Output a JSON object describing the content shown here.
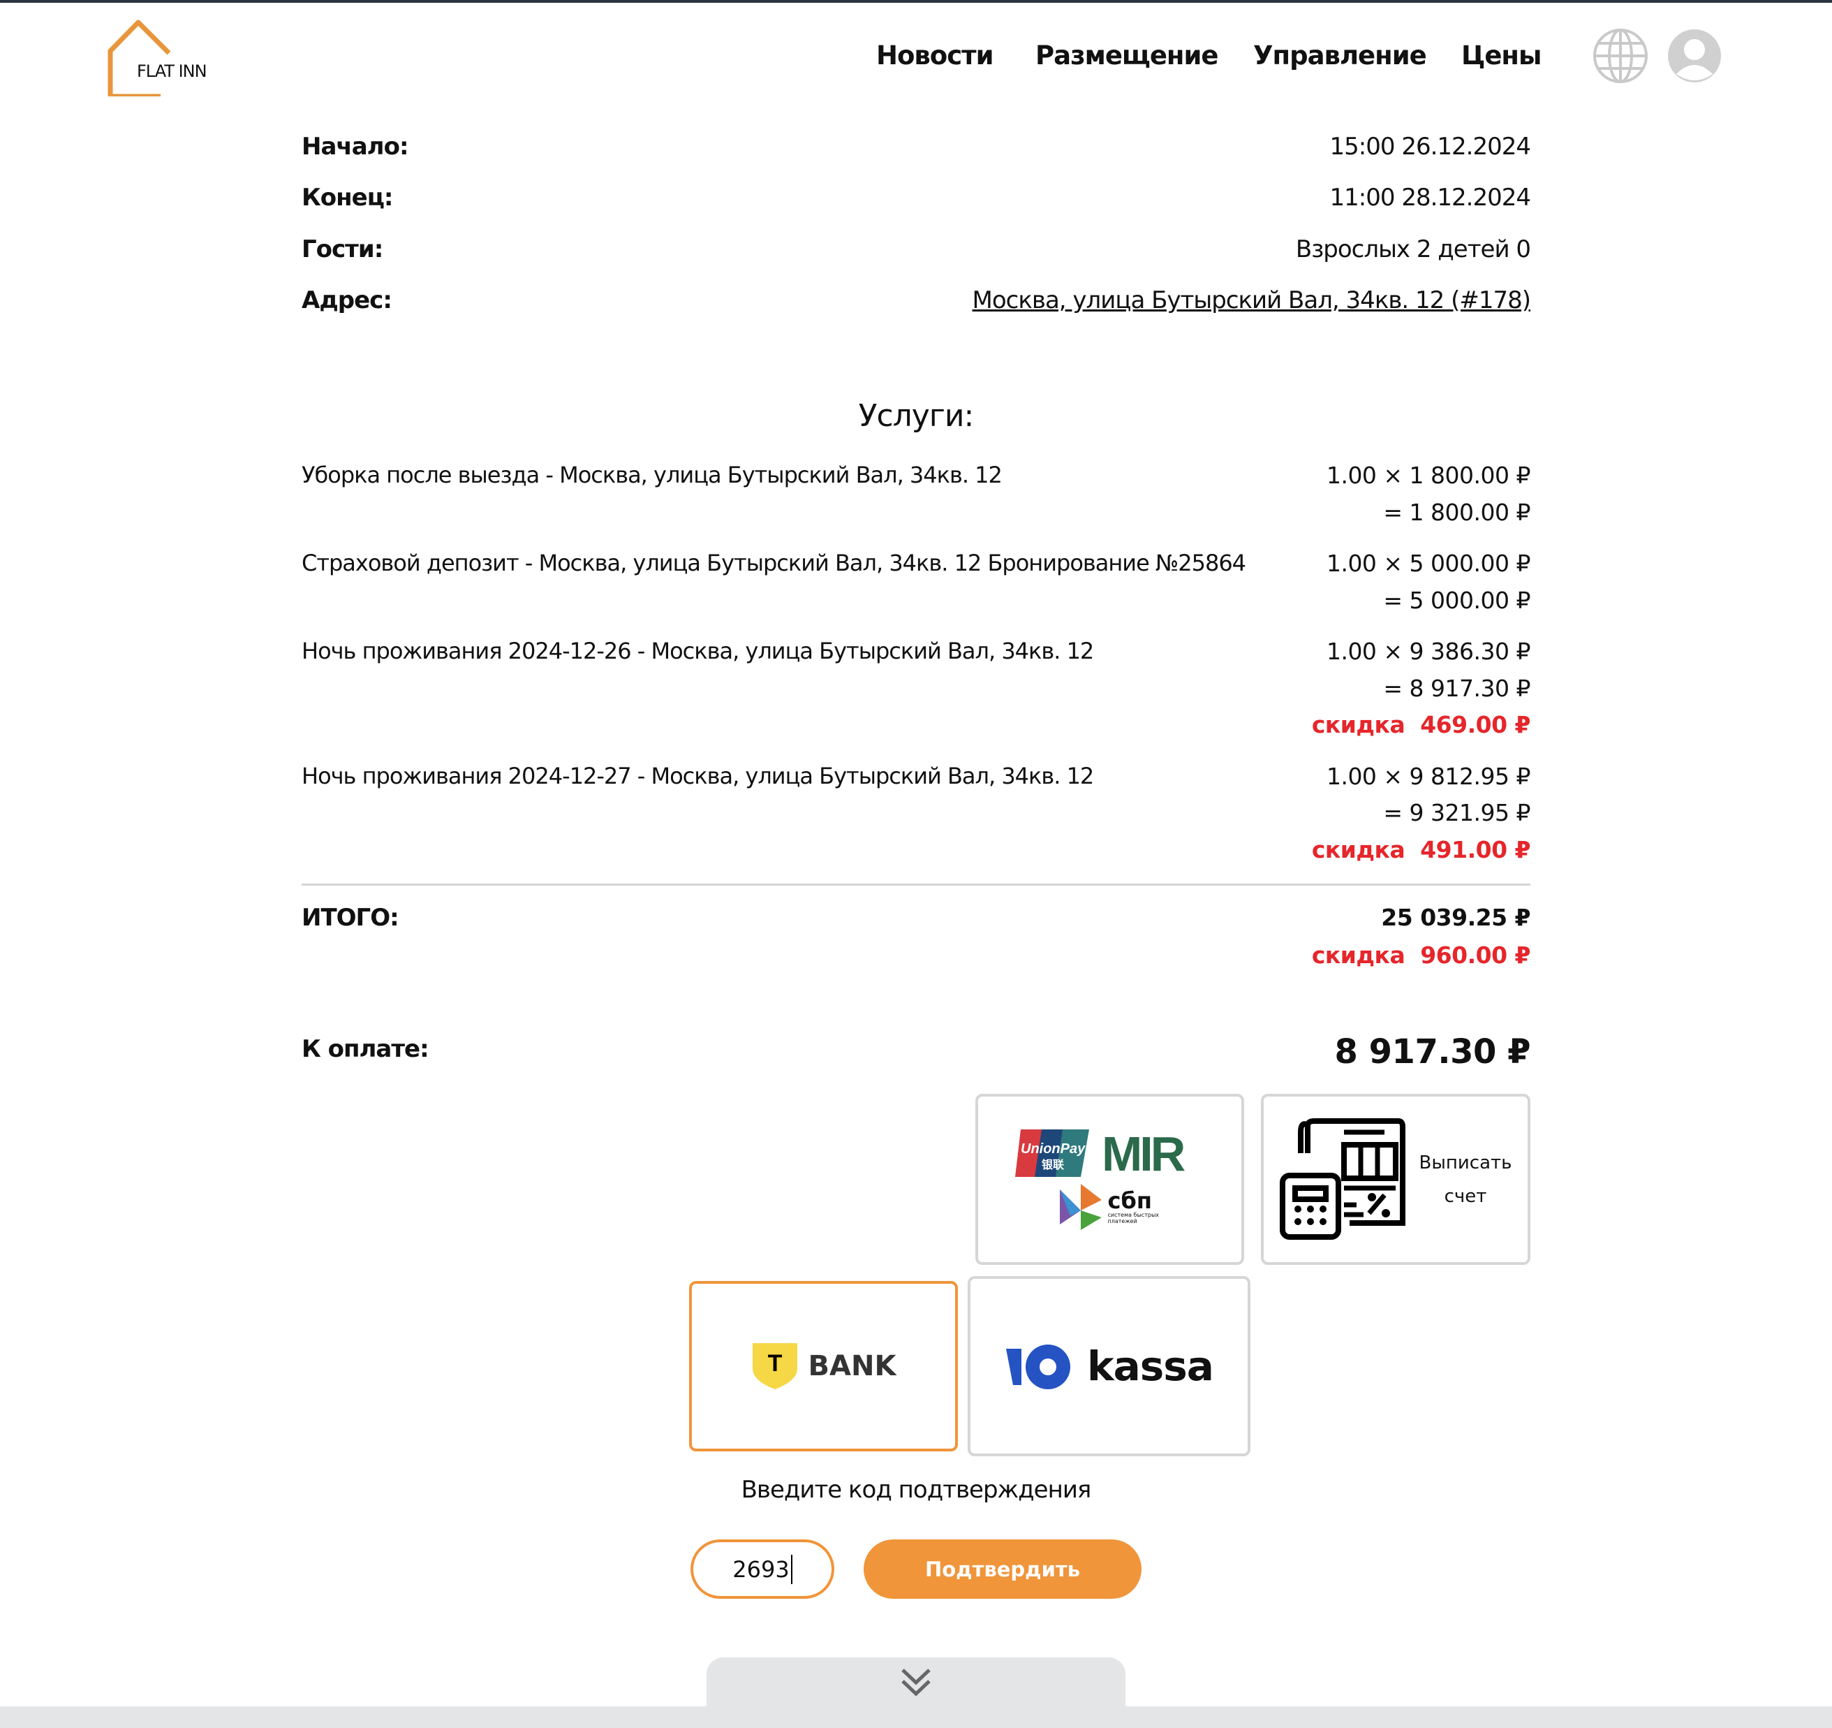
{
  "header": {
    "logo_text": "FLAT INN",
    "nav": [
      "Новости",
      "Размещение",
      "Управление",
      "Цены"
    ],
    "icons": [
      "globe-icon",
      "user-avatar-icon"
    ]
  },
  "booking": {
    "start": {
      "label": "Начало:",
      "value": "15:00 26.12.2024"
    },
    "end": {
      "label": "Конец:",
      "value": "11:00 28.12.2024"
    },
    "guests": {
      "label": "Гости:",
      "value": "Взрослых 2 детей 0"
    },
    "address": {
      "label": "Адрес:",
      "value": "Москва, улица Бутырский Вал, 34кв. 12 (#178)"
    }
  },
  "services": {
    "title": "Услуги:",
    "items": [
      {
        "name": "Уборка после выезда - Москва, улица Бутырский Вал, 34кв. 12",
        "qty_price": "1.00 × 1 800.00 ₽",
        "total": "= 1 800.00 ₽"
      },
      {
        "name": "Страховой депозит - Москва, улица Бутырский Вал, 34кв. 12 Бронирование №25864",
        "qty_price": "1.00 × 5 000.00 ₽",
        "total": "= 5 000.00 ₽"
      },
      {
        "name": "Ночь проживания 2024-12-26 - Москва, улица Бутырский Вал, 34кв. 12",
        "qty_price": "1.00 × 9 386.30 ₽",
        "total": "= 8 917.30 ₽",
        "discount": "скидка  469.00 ₽"
      },
      {
        "name": "Ночь проживания 2024-12-27 - Москва, улица Бутырский Вал, 34кв. 12",
        "qty_price": "1.00 × 9 812.95 ₽",
        "total": "= 9 321.95 ₽",
        "discount": "скидка  491.00 ₽"
      }
    ]
  },
  "totals": {
    "label": "ИТОГО:",
    "value": "25 039.25 ₽",
    "discount": "скидка  960.00 ₽",
    "pay_label": "К оплате:",
    "pay_value": "8 917.30 ₽"
  },
  "payment": {
    "cards_logos": [
      "UnionPay 银联",
      "MIR",
      "сбп",
      "система быстрых платежей"
    ],
    "invoice_label": [
      "Выписать",
      "счет"
    ],
    "tbank": "BANK",
    "tbank_letter": "T",
    "kassa": "kassa",
    "selected": "tbank",
    "accent": "#f0953a"
  },
  "confirm": {
    "prompt": "Введите код подтверждения",
    "code": "2693",
    "button": "Подтвердить"
  },
  "footer": {
    "icon": "double-chevron-down-icon"
  }
}
